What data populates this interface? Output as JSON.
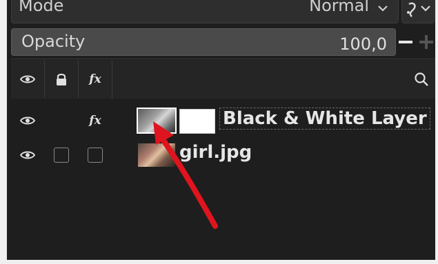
{
  "mode": {
    "label": "Mode",
    "value": "Normal"
  },
  "opacity": {
    "label": "Opacity",
    "value": "100,0",
    "minus": "−",
    "plus": "+"
  },
  "header": {
    "visibility_icon": "eye-icon",
    "lock_icon": "lock-icon",
    "fx_label": "fx",
    "search_icon": "search-icon"
  },
  "layers": [
    {
      "name": "Black & White Layer",
      "fx": "fx",
      "thumbnail": "black-and-white-preview",
      "has_mask": true
    },
    {
      "name": "girl.jpg",
      "fx": "",
      "thumbnail": "photo-preview",
      "has_mask": false
    }
  ],
  "annotation": {
    "arrow_color": "#e0141e"
  }
}
